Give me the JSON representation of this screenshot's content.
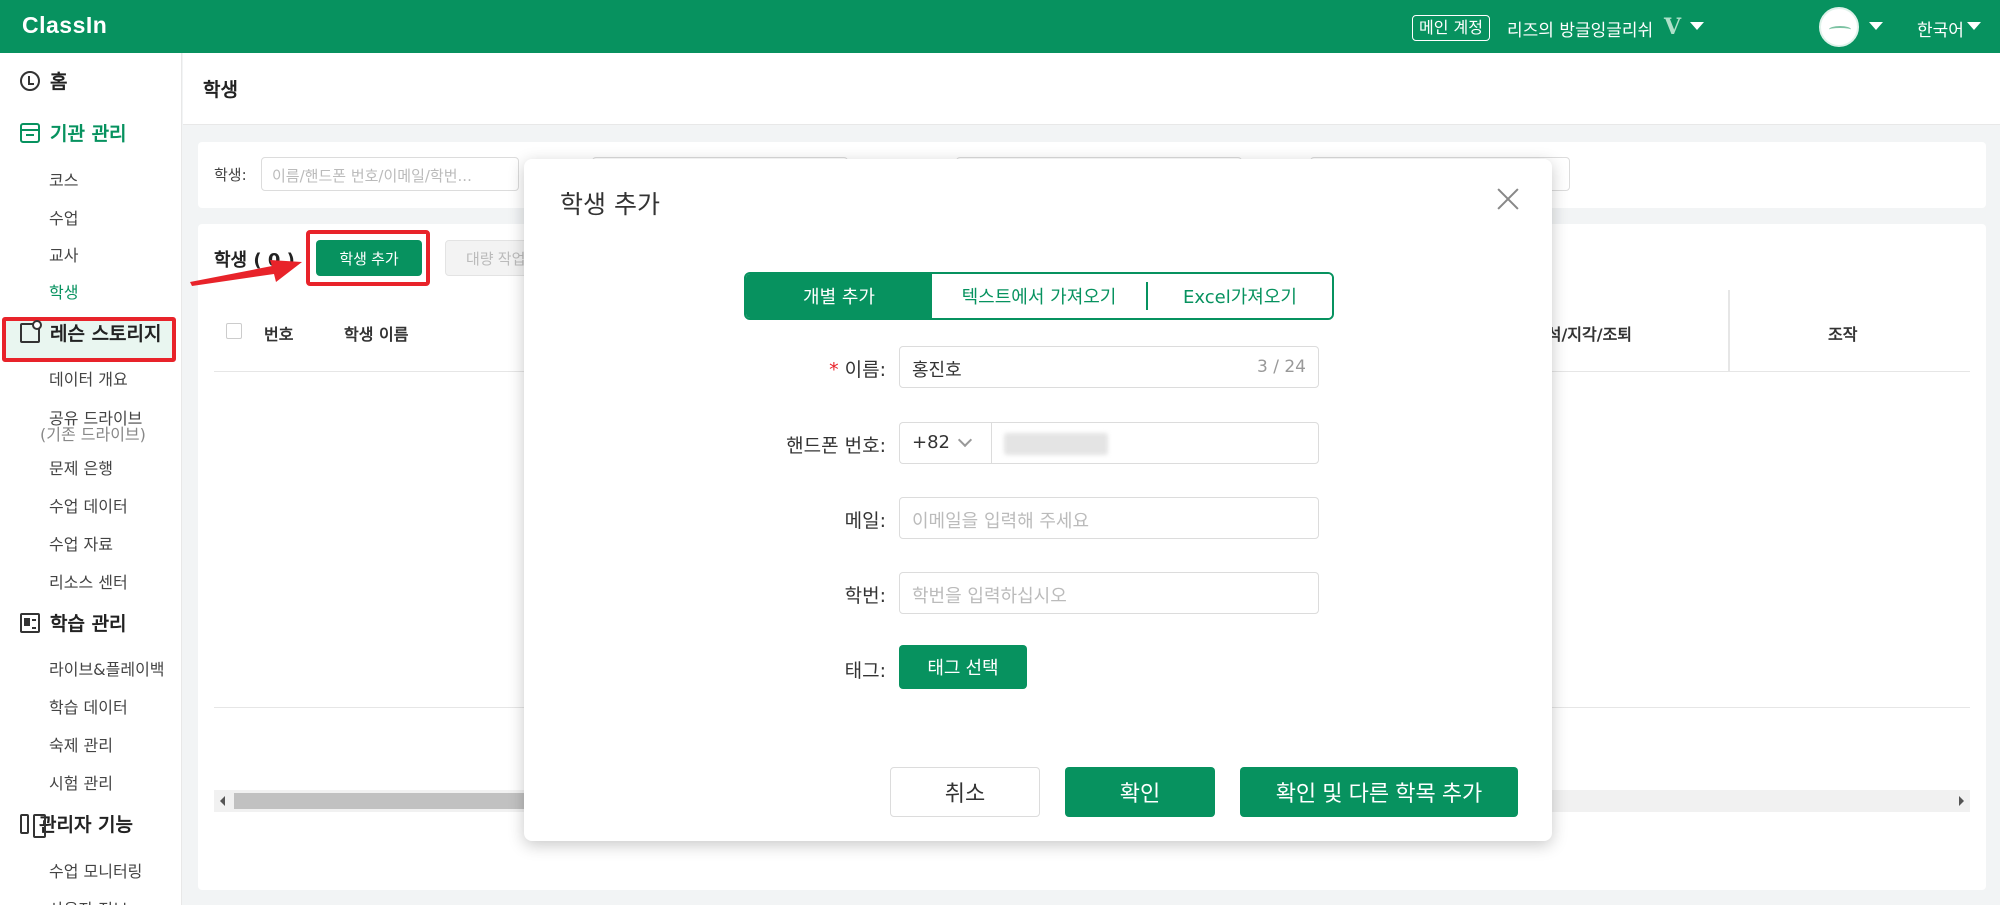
{
  "topbar": {
    "logo": "ClassIn",
    "account_badge": "메인 계정",
    "org_name": "리즈의 방글잉글리쉬",
    "org_mark": "V",
    "language": "한국어"
  },
  "sidebar": {
    "sections": [
      {
        "label": "홈",
        "icon": "clock-icon"
      },
      {
        "label": "기관 관리",
        "icon": "calendar-icon",
        "active": true
      },
      {
        "label": "레슨 스토리지",
        "icon": "folder-icon"
      },
      {
        "label": "학습 관리",
        "icon": "id-card-icon"
      },
      {
        "label": "관리자 기능",
        "icon": "admin-icon"
      }
    ],
    "org_items": [
      "코스",
      "수업",
      "교사",
      "학생"
    ],
    "lesson_items": [
      "데이터 개요",
      "공유 드라이브",
      "(기존 드라이브)",
      "문제 은행",
      "수업 데이터",
      "수업 자료",
      "리소스 센터"
    ],
    "study_items": [
      "라이브&플레이백",
      "학습 데이터",
      "숙제 관리",
      "시험 관리"
    ],
    "admin_items": [
      "수업 모니터링",
      "사용자 정보"
    ]
  },
  "page": {
    "title": "학생"
  },
  "filter": {
    "label": "학생:",
    "placeholder": "이름/핸드폰 번호/이메일/학번..."
  },
  "list": {
    "title": "학생 ( 0 )",
    "add_button": "학생 추가",
    "bulk_button": "대량 작업",
    "columns": [
      "번호",
      "학생 이름",
      "출석/지각/조퇴",
      "조작"
    ]
  },
  "modal": {
    "title": "학생 추가",
    "tabs": [
      "개별 추가",
      "텍스트에서 가져오기",
      "Excel가져오기"
    ],
    "name_label": "이름:",
    "name_required": "*",
    "name_value": "홍진호",
    "name_counter": "3 / 24",
    "phone_label": "핸드폰 번호:",
    "phone_country": "+82",
    "email_label": "메일:",
    "email_placeholder": "이메일을 입력해 주세요",
    "student_no_label": "학번:",
    "student_no_placeholder": "학번을 입력하십시오",
    "tag_label": "태그:",
    "tag_button": "태그 선택",
    "cancel": "취소",
    "confirm": "확인",
    "confirm_more": "확인 및 다른 학목 추가"
  },
  "colors": {
    "brand": "#07925f",
    "annotation": "#e8232a"
  }
}
